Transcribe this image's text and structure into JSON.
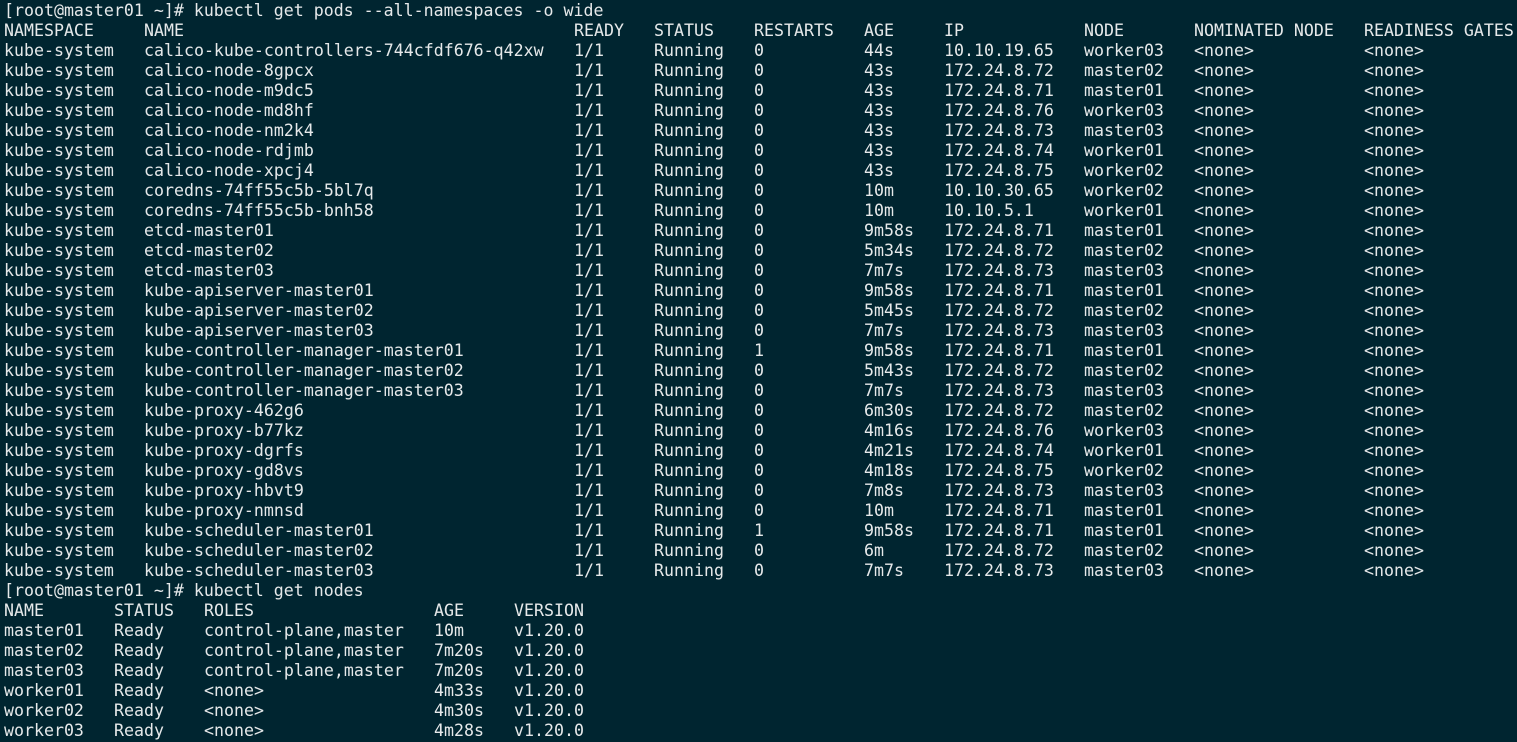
{
  "prompt": "[root@master01 ~]# ",
  "commands": [
    "kubectl get pods --all-namespaces -o wide",
    "kubectl get nodes"
  ],
  "pods": {
    "headers": [
      "NAMESPACE",
      "NAME",
      "READY",
      "STATUS",
      "RESTARTS",
      "AGE",
      "IP",
      "NODE",
      "NOMINATED NODE",
      "READINESS GATES"
    ],
    "rows": [
      [
        "kube-system",
        "calico-kube-controllers-744cfdf676-q42xw",
        "1/1",
        "Running",
        "0",
        "44s",
        "10.10.19.65",
        "worker03",
        "<none>",
        "<none>"
      ],
      [
        "kube-system",
        "calico-node-8gpcx",
        "1/1",
        "Running",
        "0",
        "43s",
        "172.24.8.72",
        "master02",
        "<none>",
        "<none>"
      ],
      [
        "kube-system",
        "calico-node-m9dc5",
        "1/1",
        "Running",
        "0",
        "43s",
        "172.24.8.71",
        "master01",
        "<none>",
        "<none>"
      ],
      [
        "kube-system",
        "calico-node-md8hf",
        "1/1",
        "Running",
        "0",
        "43s",
        "172.24.8.76",
        "worker03",
        "<none>",
        "<none>"
      ],
      [
        "kube-system",
        "calico-node-nm2k4",
        "1/1",
        "Running",
        "0",
        "43s",
        "172.24.8.73",
        "master03",
        "<none>",
        "<none>"
      ],
      [
        "kube-system",
        "calico-node-rdjmb",
        "1/1",
        "Running",
        "0",
        "43s",
        "172.24.8.74",
        "worker01",
        "<none>",
        "<none>"
      ],
      [
        "kube-system",
        "calico-node-xpcj4",
        "1/1",
        "Running",
        "0",
        "43s",
        "172.24.8.75",
        "worker02",
        "<none>",
        "<none>"
      ],
      [
        "kube-system",
        "coredns-74ff55c5b-5bl7q",
        "1/1",
        "Running",
        "0",
        "10m",
        "10.10.30.65",
        "worker02",
        "<none>",
        "<none>"
      ],
      [
        "kube-system",
        "coredns-74ff55c5b-bnh58",
        "1/1",
        "Running",
        "0",
        "10m",
        "10.10.5.1",
        "worker01",
        "<none>",
        "<none>"
      ],
      [
        "kube-system",
        "etcd-master01",
        "1/1",
        "Running",
        "0",
        "9m58s",
        "172.24.8.71",
        "master01",
        "<none>",
        "<none>"
      ],
      [
        "kube-system",
        "etcd-master02",
        "1/1",
        "Running",
        "0",
        "5m34s",
        "172.24.8.72",
        "master02",
        "<none>",
        "<none>"
      ],
      [
        "kube-system",
        "etcd-master03",
        "1/1",
        "Running",
        "0",
        "7m7s",
        "172.24.8.73",
        "master03",
        "<none>",
        "<none>"
      ],
      [
        "kube-system",
        "kube-apiserver-master01",
        "1/1",
        "Running",
        "0",
        "9m58s",
        "172.24.8.71",
        "master01",
        "<none>",
        "<none>"
      ],
      [
        "kube-system",
        "kube-apiserver-master02",
        "1/1",
        "Running",
        "0",
        "5m45s",
        "172.24.8.72",
        "master02",
        "<none>",
        "<none>"
      ],
      [
        "kube-system",
        "kube-apiserver-master03",
        "1/1",
        "Running",
        "0",
        "7m7s",
        "172.24.8.73",
        "master03",
        "<none>",
        "<none>"
      ],
      [
        "kube-system",
        "kube-controller-manager-master01",
        "1/1",
        "Running",
        "1",
        "9m58s",
        "172.24.8.71",
        "master01",
        "<none>",
        "<none>"
      ],
      [
        "kube-system",
        "kube-controller-manager-master02",
        "1/1",
        "Running",
        "0",
        "5m43s",
        "172.24.8.72",
        "master02",
        "<none>",
        "<none>"
      ],
      [
        "kube-system",
        "kube-controller-manager-master03",
        "1/1",
        "Running",
        "0",
        "7m7s",
        "172.24.8.73",
        "master03",
        "<none>",
        "<none>"
      ],
      [
        "kube-system",
        "kube-proxy-462g6",
        "1/1",
        "Running",
        "0",
        "6m30s",
        "172.24.8.72",
        "master02",
        "<none>",
        "<none>"
      ],
      [
        "kube-system",
        "kube-proxy-b77kz",
        "1/1",
        "Running",
        "0",
        "4m16s",
        "172.24.8.76",
        "worker03",
        "<none>",
        "<none>"
      ],
      [
        "kube-system",
        "kube-proxy-dgrfs",
        "1/1",
        "Running",
        "0",
        "4m21s",
        "172.24.8.74",
        "worker01",
        "<none>",
        "<none>"
      ],
      [
        "kube-system",
        "kube-proxy-gd8vs",
        "1/1",
        "Running",
        "0",
        "4m18s",
        "172.24.8.75",
        "worker02",
        "<none>",
        "<none>"
      ],
      [
        "kube-system",
        "kube-proxy-hbvt9",
        "1/1",
        "Running",
        "0",
        "7m8s",
        "172.24.8.73",
        "master03",
        "<none>",
        "<none>"
      ],
      [
        "kube-system",
        "kube-proxy-nmnsd",
        "1/1",
        "Running",
        "0",
        "10m",
        "172.24.8.71",
        "master01",
        "<none>",
        "<none>"
      ],
      [
        "kube-system",
        "kube-scheduler-master01",
        "1/1",
        "Running",
        "1",
        "9m58s",
        "172.24.8.71",
        "master01",
        "<none>",
        "<none>"
      ],
      [
        "kube-system",
        "kube-scheduler-master02",
        "1/1",
        "Running",
        "0",
        "6m",
        "172.24.8.72",
        "master02",
        "<none>",
        "<none>"
      ],
      [
        "kube-system",
        "kube-scheduler-master03",
        "1/1",
        "Running",
        "0",
        "7m7s",
        "172.24.8.73",
        "master03",
        "<none>",
        "<none>"
      ]
    ]
  },
  "nodes": {
    "headers": [
      "NAME",
      "STATUS",
      "ROLES",
      "AGE",
      "VERSION"
    ],
    "rows": [
      [
        "master01",
        "Ready",
        "control-plane,master",
        "10m",
        "v1.20.0"
      ],
      [
        "master02",
        "Ready",
        "control-plane,master",
        "7m20s",
        "v1.20.0"
      ],
      [
        "master03",
        "Ready",
        "control-plane,master",
        "7m20s",
        "v1.20.0"
      ],
      [
        "worker01",
        "Ready",
        "<none>",
        "4m33s",
        "v1.20.0"
      ],
      [
        "worker02",
        "Ready",
        "<none>",
        "4m30s",
        "v1.20.0"
      ],
      [
        "worker03",
        "Ready",
        "<none>",
        "4m28s",
        "v1.20.0"
      ]
    ]
  }
}
